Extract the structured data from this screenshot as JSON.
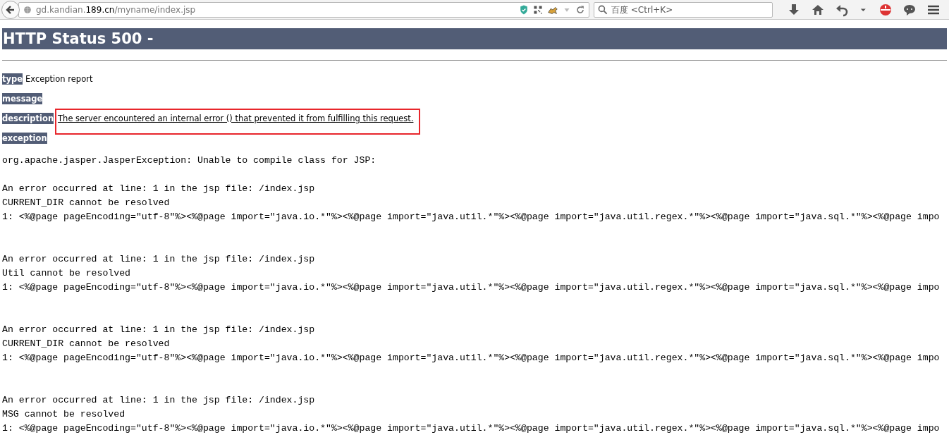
{
  "browser": {
    "url_host_prefix": "gd.kandian.",
    "url_domain": "189.cn",
    "url_path": "/myname/index.jsp",
    "search_placeholder": "百度 <Ctrl+K>"
  },
  "page": {
    "title": "HTTP Status 500 -",
    "fields": [
      {
        "label": "type",
        "value": "Exception report",
        "highlighted": false
      },
      {
        "label": "message"
      },
      {
        "label": "description",
        "value": "The server encountered an internal error () that prevented it from fulfilling this request.",
        "highlighted": true
      },
      {
        "label": "exception"
      }
    ],
    "exception_text": "org.apache.jasper.JasperException: Unable to compile class for JSP:",
    "errors": [
      {
        "location": "An error occurred at line: 1 in the jsp file: /index.jsp",
        "message": "CURRENT_DIR cannot be resolved",
        "source": "1: <%@page pageEncoding=\"utf-8\"%><%@page import=\"java.io.*\"%><%@page import=\"java.util.*\"%><%@page import=\"java.util.regex.*\"%><%@page import=\"java.sql.*\"%><%@page impo"
      },
      {
        "location": "An error occurred at line: 1 in the jsp file: /index.jsp",
        "message": "Util cannot be resolved",
        "source": "1: <%@page pageEncoding=\"utf-8\"%><%@page import=\"java.io.*\"%><%@page import=\"java.util.*\"%><%@page import=\"java.util.regex.*\"%><%@page import=\"java.sql.*\"%><%@page impo"
      },
      {
        "location": "An error occurred at line: 1 in the jsp file: /index.jsp",
        "message": "CURRENT_DIR cannot be resolved",
        "source": "1: <%@page pageEncoding=\"utf-8\"%><%@page import=\"java.io.*\"%><%@page import=\"java.util.*\"%><%@page import=\"java.util.regex.*\"%><%@page import=\"java.sql.*\"%><%@page impo"
      },
      {
        "location": "An error occurred at line: 1 in the jsp file: /index.jsp",
        "message": "MSG cannot be resolved",
        "source": "1: <%@page pageEncoding=\"utf-8\"%><%@page import=\"java.io.*\"%><%@page import=\"java.util.*\"%><%@page import=\"java.util.regex.*\"%><%@page import=\"java.sql.*\"%><%@page impo"
      }
    ]
  }
}
